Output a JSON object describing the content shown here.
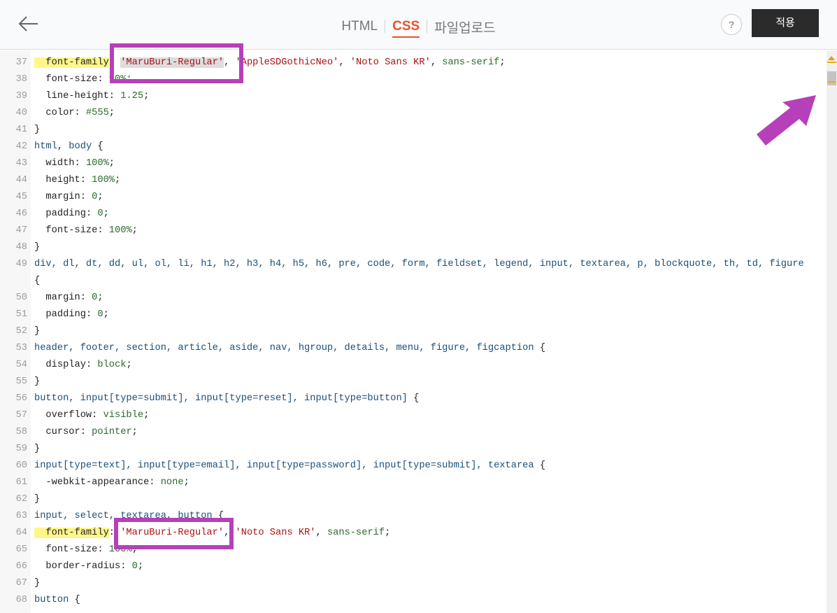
{
  "header": {
    "tabs": [
      "HTML",
      "CSS",
      "파일업로드"
    ],
    "active_tab": "CSS",
    "help_label": "?",
    "apply_label": "적용"
  },
  "editor": {
    "lines": [
      {
        "num": "37",
        "parts": [
          [
            "prop hl",
            "  font-family"
          ],
          [
            "",
            ": "
          ],
          [
            "str strhl",
            "'MaruBuri-Regular'"
          ],
          [
            "",
            ", "
          ],
          [
            "str",
            "'AppleSDGothicNeo'"
          ],
          [
            "",
            ", "
          ],
          [
            "str",
            "'Noto Sans KR'"
          ],
          [
            "",
            ", "
          ],
          [
            "val",
            "sans-serif"
          ],
          [
            "",
            ";"
          ]
        ]
      },
      {
        "num": "38",
        "parts": [
          [
            "prop",
            "  font-size"
          ],
          [
            "",
            ": "
          ],
          [
            "val",
            "90%"
          ],
          [
            "",
            ";"
          ]
        ]
      },
      {
        "num": "39",
        "parts": [
          [
            "prop",
            "  line-height"
          ],
          [
            "",
            ": "
          ],
          [
            "val",
            "1.25"
          ],
          [
            "",
            ";"
          ]
        ]
      },
      {
        "num": "40",
        "parts": [
          [
            "prop",
            "  color"
          ],
          [
            "",
            ": "
          ],
          [
            "val",
            "#555"
          ],
          [
            "",
            ";"
          ]
        ]
      },
      {
        "num": "41",
        "parts": [
          [
            "",
            "}"
          ]
        ]
      },
      {
        "num": "42",
        "parts": [
          [
            "sel",
            "html"
          ],
          [
            "",
            ", "
          ],
          [
            "sel",
            "body"
          ],
          [
            "",
            " {"
          ]
        ]
      },
      {
        "num": "43",
        "parts": [
          [
            "prop",
            "  width"
          ],
          [
            "",
            ": "
          ],
          [
            "val",
            "100%"
          ],
          [
            "",
            ";"
          ]
        ]
      },
      {
        "num": "44",
        "parts": [
          [
            "prop",
            "  height"
          ],
          [
            "",
            ": "
          ],
          [
            "val",
            "100%"
          ],
          [
            "",
            ";"
          ]
        ]
      },
      {
        "num": "45",
        "parts": [
          [
            "prop",
            "  margin"
          ],
          [
            "",
            ": "
          ],
          [
            "val",
            "0"
          ],
          [
            "",
            ";"
          ]
        ]
      },
      {
        "num": "46",
        "parts": [
          [
            "prop",
            "  padding"
          ],
          [
            "",
            ": "
          ],
          [
            "val",
            "0"
          ],
          [
            "",
            ";"
          ]
        ]
      },
      {
        "num": "47",
        "parts": [
          [
            "prop",
            "  font-size"
          ],
          [
            "",
            ": "
          ],
          [
            "val",
            "100%"
          ],
          [
            "",
            ";"
          ]
        ]
      },
      {
        "num": "48",
        "parts": [
          [
            "",
            "}"
          ]
        ]
      },
      {
        "num": "49",
        "parts": [
          [
            "sel",
            "div, dl, dt, dd, ul, ol, li, h1, h2, h3, h4, h5, h6, pre, code, form, fieldset, legend, input, textarea, p, blockquote, th, td, figure"
          ]
        ]
      },
      {
        "num": "",
        "parts": [
          [
            "",
            "{"
          ]
        ]
      },
      {
        "num": "50",
        "parts": [
          [
            "prop",
            "  margin"
          ],
          [
            "",
            ": "
          ],
          [
            "val",
            "0"
          ],
          [
            "",
            ";"
          ]
        ]
      },
      {
        "num": "51",
        "parts": [
          [
            "prop",
            "  padding"
          ],
          [
            "",
            ": "
          ],
          [
            "val",
            "0"
          ],
          [
            "",
            ";"
          ]
        ]
      },
      {
        "num": "52",
        "parts": [
          [
            "",
            "}"
          ]
        ]
      },
      {
        "num": "53",
        "parts": [
          [
            "sel",
            "header, footer, section, article, aside, nav, hgroup, details, menu, figure, figcaption"
          ],
          [
            "",
            " {"
          ]
        ]
      },
      {
        "num": "54",
        "parts": [
          [
            "prop",
            "  display"
          ],
          [
            "",
            ": "
          ],
          [
            "val",
            "block"
          ],
          [
            "",
            ";"
          ]
        ]
      },
      {
        "num": "55",
        "parts": [
          [
            "",
            "}"
          ]
        ]
      },
      {
        "num": "56",
        "parts": [
          [
            "sel",
            "button, input[type=submit], input[type=reset], input[type=button]"
          ],
          [
            "",
            " {"
          ]
        ]
      },
      {
        "num": "57",
        "parts": [
          [
            "prop",
            "  overflow"
          ],
          [
            "",
            ": "
          ],
          [
            "val",
            "visible"
          ],
          [
            "",
            ";"
          ]
        ]
      },
      {
        "num": "58",
        "parts": [
          [
            "prop",
            "  cursor"
          ],
          [
            "",
            ": "
          ],
          [
            "val",
            "pointer"
          ],
          [
            "",
            ";"
          ]
        ]
      },
      {
        "num": "59",
        "parts": [
          [
            "",
            "}"
          ]
        ]
      },
      {
        "num": "60",
        "parts": [
          [
            "sel",
            "input[type=text], input[type=email], input[type=password], input[type=submit], textarea"
          ],
          [
            "",
            " {"
          ]
        ]
      },
      {
        "num": "61",
        "parts": [
          [
            "prop",
            "  -webkit-appearance"
          ],
          [
            "",
            ": "
          ],
          [
            "val",
            "none"
          ],
          [
            "",
            ";"
          ]
        ]
      },
      {
        "num": "62",
        "parts": [
          [
            "",
            "}"
          ]
        ]
      },
      {
        "num": "63",
        "parts": [
          [
            "sel",
            "input, select, textarea, button"
          ],
          [
            "",
            " {"
          ]
        ]
      },
      {
        "num": "64",
        "parts": [
          [
            "prop hl",
            "  font-family"
          ],
          [
            "",
            ": "
          ],
          [
            "str",
            "'MaruBuri-Regular'"
          ],
          [
            "",
            ", "
          ],
          [
            "str",
            "'Noto Sans KR'"
          ],
          [
            "",
            ", "
          ],
          [
            "val",
            "sans-serif"
          ],
          [
            "",
            ";"
          ]
        ]
      },
      {
        "num": "65",
        "parts": [
          [
            "prop",
            "  font-size"
          ],
          [
            "",
            ": "
          ],
          [
            "val",
            "100%"
          ],
          [
            "",
            ";"
          ]
        ]
      },
      {
        "num": "66",
        "parts": [
          [
            "prop",
            "  border-radius"
          ],
          [
            "",
            ": "
          ],
          [
            "val",
            "0"
          ],
          [
            "",
            ";"
          ]
        ]
      },
      {
        "num": "67",
        "parts": [
          [
            "",
            "}"
          ]
        ]
      },
      {
        "num": "68",
        "parts": [
          [
            "sel",
            "button"
          ],
          [
            "",
            " {"
          ]
        ]
      }
    ]
  },
  "colors": {
    "accent": "#e8532b",
    "annotation": "#b640b9",
    "apply_bg": "#2b2b2b"
  }
}
